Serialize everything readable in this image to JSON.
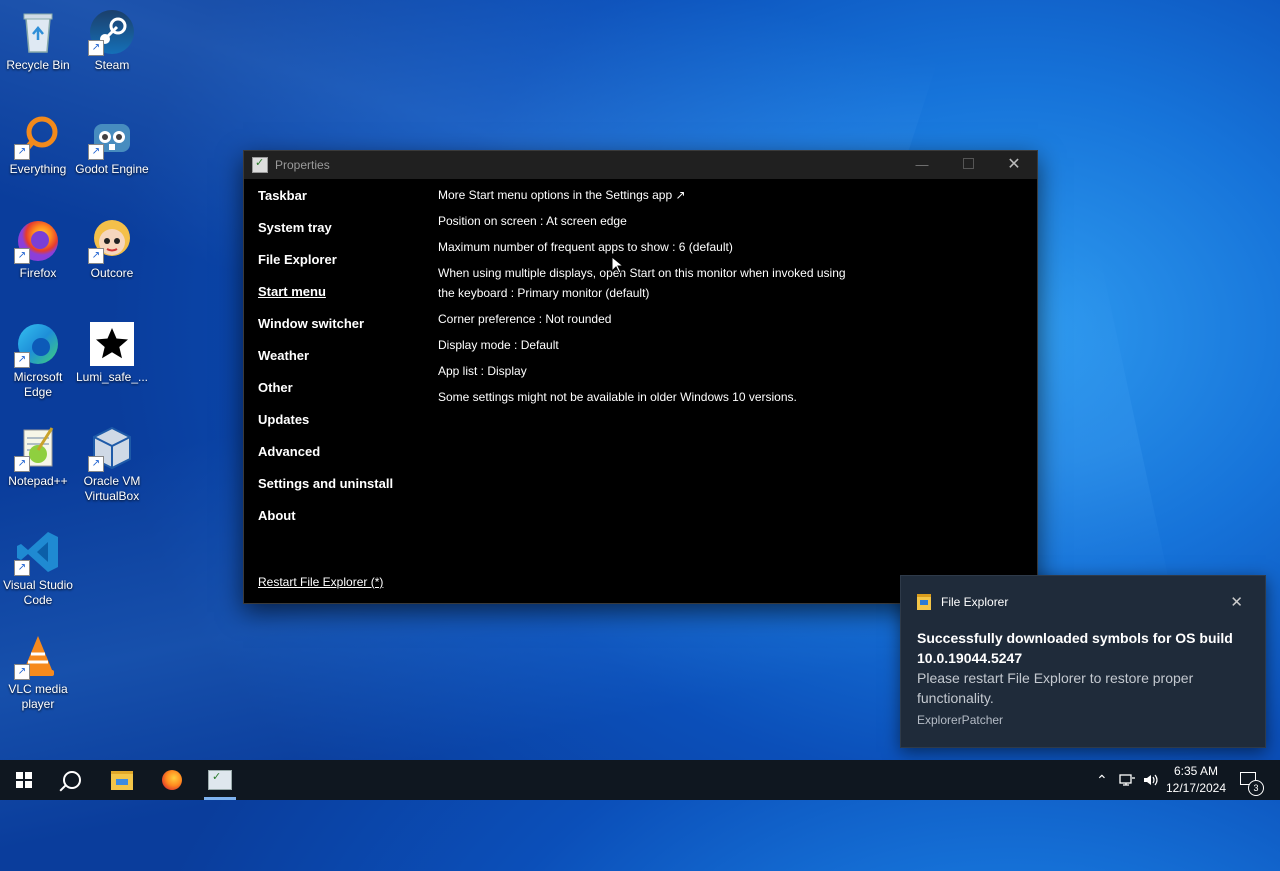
{
  "desktop": {
    "icons": [
      {
        "label": "Recycle Bin",
        "icon": "recycle-bin-icon"
      },
      {
        "label": "Steam",
        "icon": "steam-icon"
      },
      {
        "label": "Everything",
        "icon": "everything-search-icon"
      },
      {
        "label": "Godot Engine",
        "icon": "godot-icon"
      },
      {
        "label": "Firefox",
        "icon": "firefox-icon"
      },
      {
        "label": "Outcore",
        "icon": "outcore-icon"
      },
      {
        "label": "Microsoft Edge",
        "icon": "edge-icon"
      },
      {
        "label": "Lumi_safe_...",
        "icon": "star-icon"
      },
      {
        "label": "Notepad++",
        "icon": "notepadpp-icon"
      },
      {
        "label": "Oracle VM VirtualBox",
        "icon": "virtualbox-icon"
      },
      {
        "label": "Visual Studio Code",
        "icon": "vscode-icon"
      },
      {
        "label": "VLC media player",
        "icon": "vlc-icon"
      }
    ],
    "shortcut_glyph": "↗"
  },
  "window": {
    "title": "Properties",
    "min_glyph": "—",
    "close_glyph": "✕",
    "nav": [
      {
        "label": "Taskbar"
      },
      {
        "label": "System tray"
      },
      {
        "label": "File Explorer"
      },
      {
        "label": "Start menu"
      },
      {
        "label": "Window switcher"
      },
      {
        "label": "Weather"
      },
      {
        "label": "Other"
      },
      {
        "label": "Updates"
      },
      {
        "label": "Advanced"
      },
      {
        "label": "Settings and uninstall"
      },
      {
        "label": "About"
      }
    ],
    "active_nav": "Start menu",
    "restart_link": "Restart File Explorer (*)",
    "settings": [
      "More Start menu options in the Settings app ↗",
      "Position on screen : At screen edge",
      "Maximum number of frequent apps to show : 6 (default)",
      "When using multiple displays, open Start on this monitor when invoked using the keyboard : Primary monitor (default)",
      "Corner preference : Not rounded",
      "Display mode : Default",
      "App list : Display",
      "Some settings might not be available in older Windows 10 versions."
    ]
  },
  "toast": {
    "app": "File Explorer",
    "close_glyph": "✕",
    "headline": "Successfully downloaded symbols for OS build 10.0.19044.5247",
    "body": "Please restart File Explorer to restore proper functionality.",
    "attribution": "ExplorerPatcher"
  },
  "taskbar": {
    "tray_chevron": "⌃",
    "volume_glyph": "🔊",
    "time": "6:35 AM",
    "date": "12/17/2024",
    "notification_count": "3"
  }
}
